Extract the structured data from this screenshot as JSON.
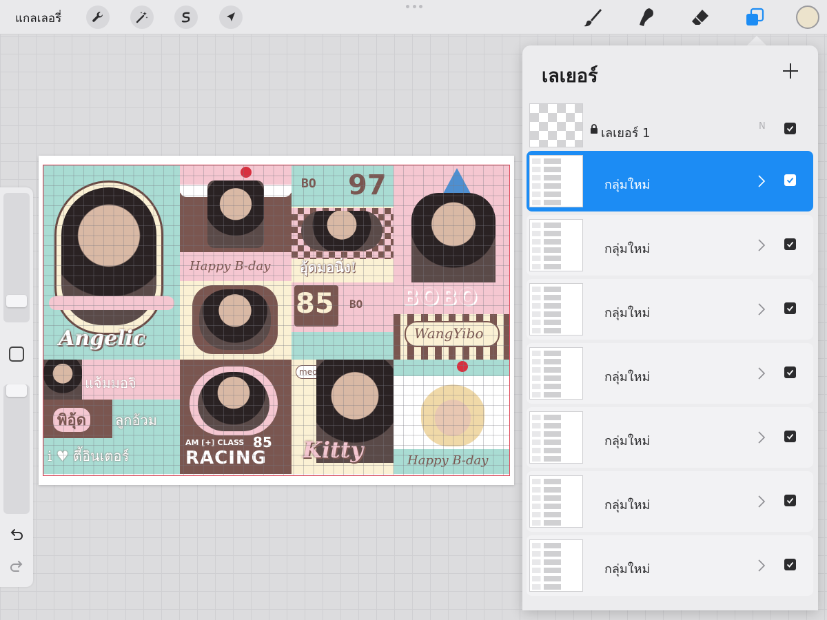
{
  "topbar": {
    "gallery_label": "แกลเลอรี่",
    "tools_left": [
      "wrench-icon",
      "magic-wand-icon",
      "selection-s-icon",
      "transform-arrow-icon"
    ],
    "tools_right": [
      "brush-icon",
      "smudge-icon",
      "eraser-icon",
      "layers-icon"
    ],
    "active_tool": "layers-icon",
    "current_color": "#ece3cc",
    "accent_color": "#1c8cf4"
  },
  "sidebar": {
    "controls": [
      "brush-size-slider",
      "modify-button",
      "opacity-slider",
      "undo-icon",
      "redo-icon"
    ]
  },
  "artwork": {
    "texts": {
      "angelic": "Angelic",
      "happy_bday_1": "Happy B-day",
      "num_97": "97",
      "bo_1": "BO",
      "thai_caption_1": "อุ้ดมอนิ่ง!",
      "num_85": "85",
      "bo_2": "BO",
      "bobo": "BOBO",
      "wangyibo": "WangYibo",
      "thai_yaem": "แจ้มมอจิ",
      "thai_phi": "พิอุ้ด",
      "thai_luk": "ลูกอ้วม",
      "thai_tee": "i ♥ ตี้อินเตอร์",
      "am_class": "AM [+] CLASS",
      "num_85_small": "85",
      "racing": "RACING",
      "meow": "meow!",
      "kitty": "Kitty",
      "happy_bday_2": "Happy B-day"
    },
    "colors": {
      "mint": "#a9dcd3",
      "pink": "#f5c7d1",
      "brown": "#7a5650",
      "cream": "#fbf1d4",
      "frame_red": "#e0485a"
    }
  },
  "layers_panel": {
    "title": "เลเยอร์",
    "add_icon": "plus-icon",
    "top_layer": {
      "name": "เลเยอร์ 1",
      "locked": true,
      "blend_mode": "N",
      "visible": true
    },
    "groups": [
      {
        "name": "กลุ่มใหม่",
        "selected": true,
        "visible": true
      },
      {
        "name": "กลุ่มใหม่",
        "selected": false,
        "visible": true
      },
      {
        "name": "กลุ่มใหม่",
        "selected": false,
        "visible": true
      },
      {
        "name": "กลุ่มใหม่",
        "selected": false,
        "visible": true
      },
      {
        "name": "กลุ่มใหม่",
        "selected": false,
        "visible": true
      },
      {
        "name": "กลุ่มใหม่",
        "selected": false,
        "visible": true
      },
      {
        "name": "กลุ่มใหม่",
        "selected": false,
        "visible": true
      }
    ]
  }
}
